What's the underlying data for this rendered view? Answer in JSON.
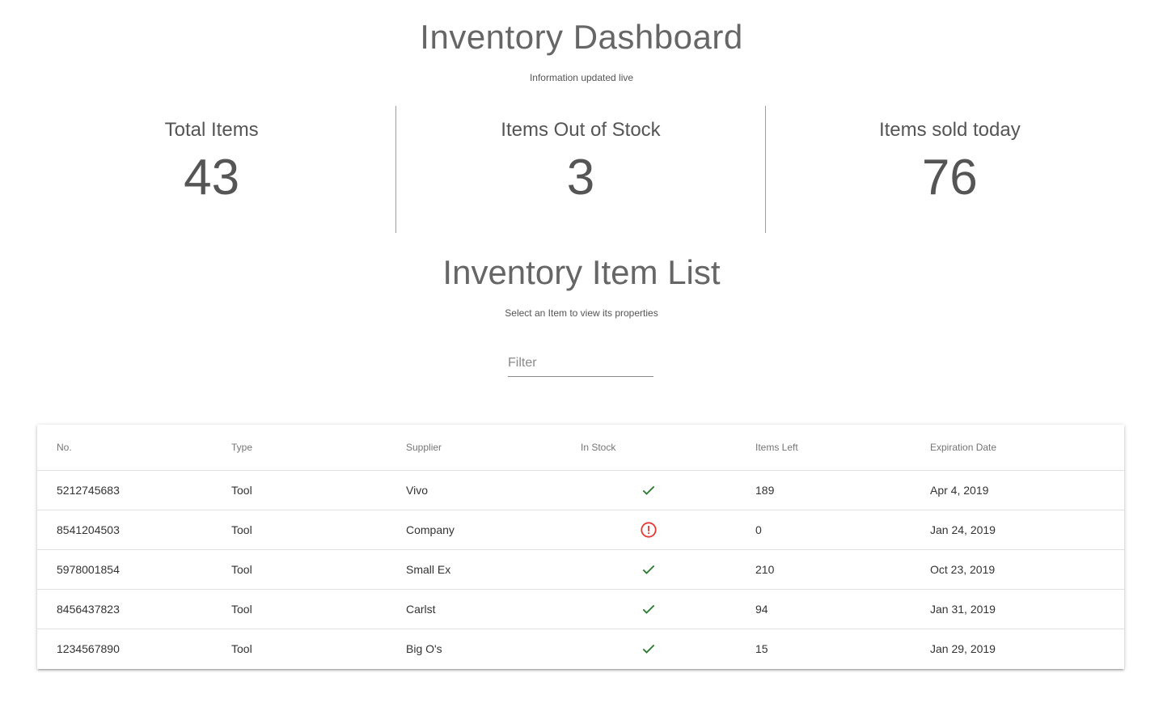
{
  "header": {
    "title": "Inventory Dashboard",
    "subtitle": "Information updated live"
  },
  "stats": [
    {
      "label": "Total Items",
      "value": "43"
    },
    {
      "label": "Items Out of Stock",
      "value": "3"
    },
    {
      "label": "Items sold today",
      "value": "76"
    }
  ],
  "list": {
    "title": "Inventory Item List",
    "subtitle": "Select an Item to view its properties",
    "filter_placeholder": "Filter",
    "filter_value": ""
  },
  "table": {
    "columns": [
      "No.",
      "Type",
      "Supplier",
      "In Stock",
      "Items Left",
      "Expiration Date"
    ],
    "rows": [
      {
        "no": "5212745683",
        "type": "Tool",
        "supplier": "Vivo",
        "in_stock": "check-icon",
        "items_left": "189",
        "expiration": "Apr 4, 2019"
      },
      {
        "no": "8541204503",
        "type": "Tool",
        "supplier": "Company",
        "in_stock": "error-icon",
        "items_left": "0",
        "expiration": "Jan 24, 2019"
      },
      {
        "no": "5978001854",
        "type": "Tool",
        "supplier": "Small Ex",
        "in_stock": "check-icon",
        "items_left": "210",
        "expiration": "Oct 23, 2019"
      },
      {
        "no": "8456437823",
        "type": "Tool",
        "supplier": "Carlst",
        "in_stock": "check-icon",
        "items_left": "94",
        "expiration": "Jan 31, 2019"
      },
      {
        "no": "1234567890",
        "type": "Tool",
        "supplier": "Big O's",
        "in_stock": "check-icon",
        "items_left": "15",
        "expiration": "Jan 29, 2019"
      }
    ]
  },
  "colors": {
    "check": "#2e7d32",
    "error": "#e53935"
  }
}
